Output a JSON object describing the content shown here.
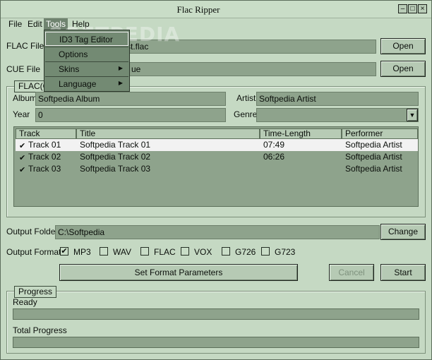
{
  "window": {
    "title": "Flac Ripper"
  },
  "menubar": {
    "file": "File",
    "edit": "Edit",
    "tools": "Tools",
    "help": "Help"
  },
  "watermark": "SOFTPEDIA",
  "tools_menu": {
    "items": [
      {
        "label": "ID3 Tag Editor",
        "submenu": false
      },
      {
        "label": "Options",
        "submenu": false
      },
      {
        "label": "Skins",
        "submenu": true
      },
      {
        "label": "Language",
        "submenu": true
      }
    ]
  },
  "flac_file": {
    "label": "FLAC File",
    "value_suffix": "st.flac",
    "open_label": "Open"
  },
  "cue_file": {
    "label": "CUE File",
    "value_suffix": "ue",
    "open_label": "Open"
  },
  "flac_group": {
    "title": "FLAC(C",
    "album_label": "Album",
    "album_value": "Softpedia Album",
    "artist_label": "Artist",
    "artist_value": "Softpedia Artist",
    "year_label": "Year",
    "year_value": "0",
    "genre_label": "Genre",
    "genre_value": ""
  },
  "tracks": {
    "headers": [
      "Track",
      "Title",
      "Time-Length",
      "Performer"
    ],
    "rows": [
      {
        "track": "Track 01",
        "title": "Softpedia Track 01",
        "time": "07:49",
        "performer": "Softpedia Artist",
        "checked": true
      },
      {
        "track": "Track 02",
        "title": "Softpedia Track 02",
        "time": "06:26",
        "performer": "Softpedia Artist",
        "checked": true
      },
      {
        "track": "Track 03",
        "title": "Softpedia Track 03",
        "time": "",
        "performer": "Softpedia Artist",
        "checked": true
      }
    ]
  },
  "output_folder": {
    "label": "Output Folder",
    "value": "C:\\Softpedia",
    "change_label": "Change"
  },
  "output_format": {
    "label": "Output Format:",
    "formats": [
      {
        "name": "MP3",
        "checked": true
      },
      {
        "name": "WAV",
        "checked": false
      },
      {
        "name": "FLAC",
        "checked": false
      },
      {
        "name": "VOX",
        "checked": false
      },
      {
        "name": "G726",
        "checked": false
      },
      {
        "name": "G723",
        "checked": false
      }
    ]
  },
  "actions": {
    "set_format": "Set Format Parameters",
    "cancel": "Cancel",
    "start": "Start"
  },
  "progress": {
    "title": "Progress",
    "status": "Ready",
    "status_value": 0,
    "total_label": "Total Progress",
    "total_value": 0
  },
  "colors": {
    "background": "#c5d9c3",
    "field": "#8ea38c",
    "menu": "#738a73",
    "selection": "#f2f2f2"
  },
  "icons": {
    "check": "✔",
    "submenu_arrow": "▶",
    "dropdown": "▼",
    "minimize": "–",
    "maximize": "□",
    "close": "×"
  }
}
